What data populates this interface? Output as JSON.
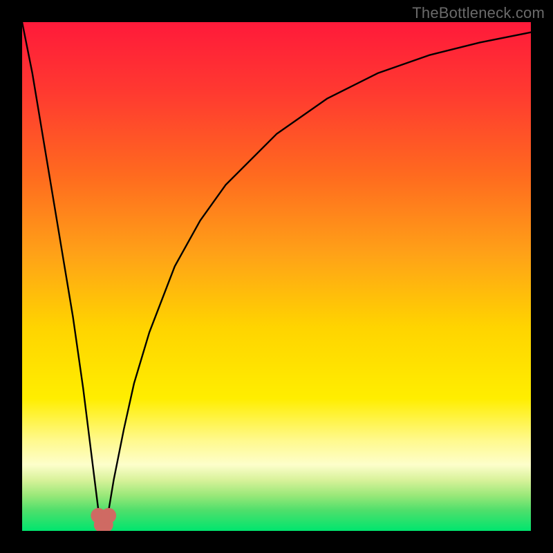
{
  "watermark": "TheBottleneck.com",
  "colors": {
    "black": "#000000",
    "curve": "#000000",
    "marker": "#cf6a63"
  },
  "gradient_stops": [
    {
      "pct": 0,
      "color": "#ff1a3a"
    },
    {
      "pct": 14,
      "color": "#ff3a30"
    },
    {
      "pct": 30,
      "color": "#ff6a1f"
    },
    {
      "pct": 46,
      "color": "#ffa317"
    },
    {
      "pct": 60,
      "color": "#ffd400"
    },
    {
      "pct": 74,
      "color": "#ffee00"
    },
    {
      "pct": 82,
      "color": "#fff98a"
    },
    {
      "pct": 87,
      "color": "#fdfecb"
    },
    {
      "pct": 90,
      "color": "#d8f29a"
    },
    {
      "pct": 93,
      "color": "#9ae879"
    },
    {
      "pct": 96,
      "color": "#4edf6b"
    },
    {
      "pct": 100,
      "color": "#00e56e"
    }
  ],
  "chart_data": {
    "type": "line",
    "title": "",
    "xlabel": "",
    "ylabel": "",
    "xlim": [
      0,
      100
    ],
    "ylim": [
      0,
      100
    ],
    "series": [
      {
        "name": "bottleneck-curve",
        "x": [
          0,
          2,
          4,
          6,
          8,
          10,
          12,
          14,
          15,
          15.5,
          16,
          16.5,
          17,
          18,
          20,
          22,
          25,
          30,
          35,
          40,
          50,
          60,
          70,
          80,
          90,
          100
        ],
        "y": [
          100,
          90,
          78,
          66,
          54,
          42,
          28,
          12,
          4,
          1,
          0.5,
          1,
          4,
          10,
          20,
          29,
          39,
          52,
          61,
          68,
          78,
          85,
          90,
          93.5,
          96,
          98
        ]
      }
    ],
    "markers": [
      {
        "name": "min-left",
        "x": 15.0,
        "y": 3.0
      },
      {
        "name": "min-bottom-l",
        "x": 15.6,
        "y": 1.2
      },
      {
        "name": "min-bottom-r",
        "x": 16.4,
        "y": 1.2
      },
      {
        "name": "min-right",
        "x": 17.0,
        "y": 3.0
      }
    ],
    "legend": false,
    "grid": false
  }
}
